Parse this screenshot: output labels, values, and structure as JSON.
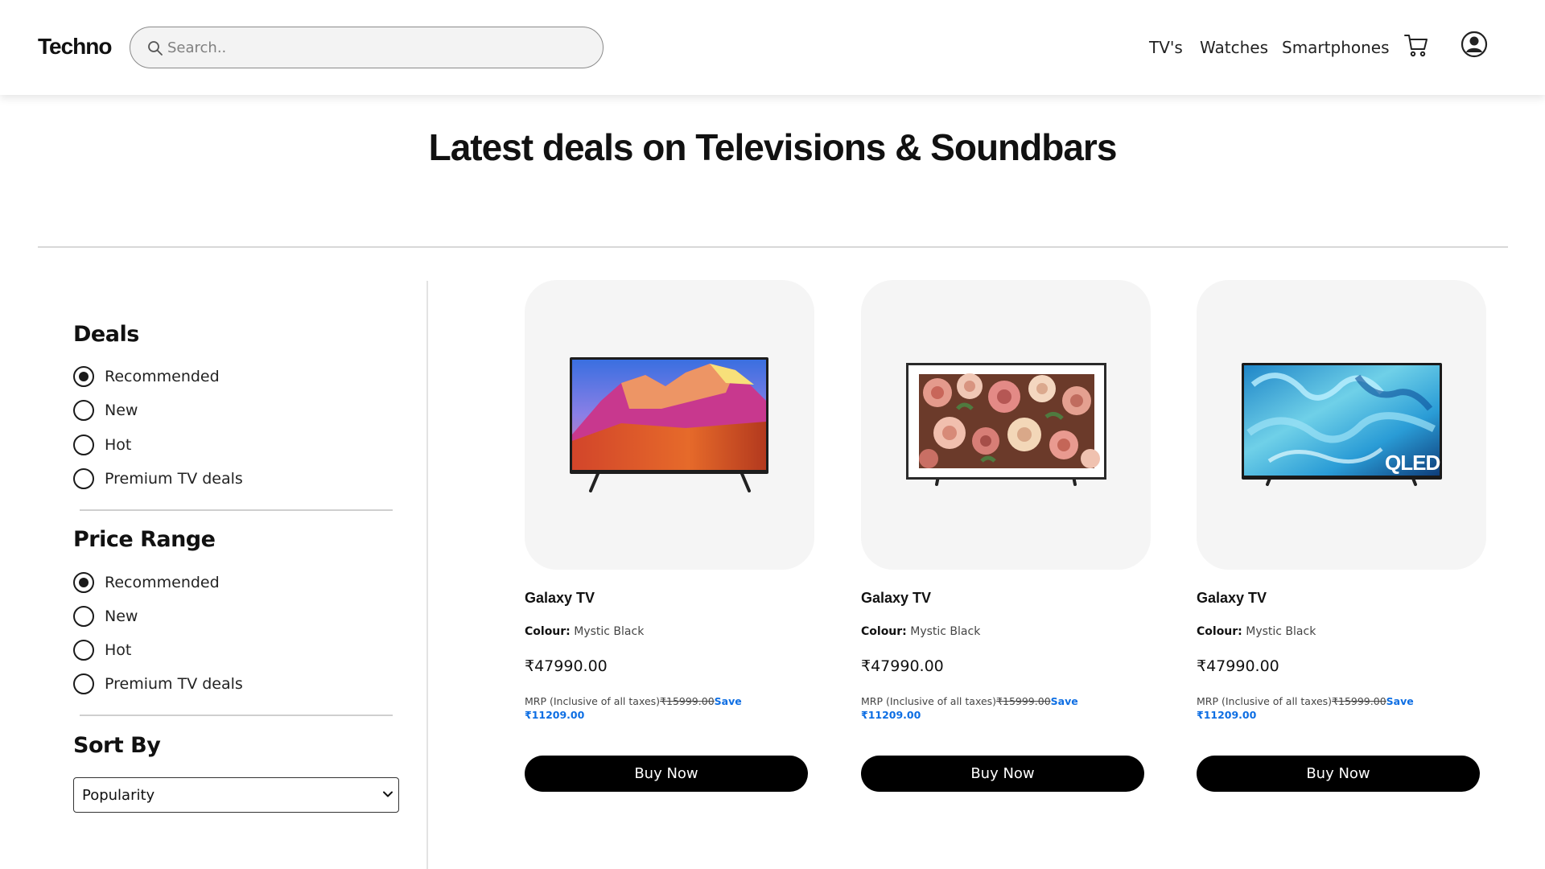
{
  "header": {
    "logo": "Techno",
    "search_placeholder": "Search..",
    "nav": [
      "TV's",
      "Watches",
      "Smartphones"
    ],
    "icons": {
      "search": "search-icon",
      "cart": "cart-icon",
      "account": "user-circle-icon"
    }
  },
  "hero": {
    "title": "Latest deals on Televisions & Soundbars"
  },
  "filters": {
    "deals": {
      "title": "Deals",
      "options": [
        "Recommended",
        "New",
        "Hot",
        "Premium TV deals"
      ],
      "selected": "Recommended"
    },
    "price_range": {
      "title": "Price Range",
      "options": [
        "Recommended",
        "New",
        "Hot",
        "Premium TV deals"
      ],
      "selected": "Recommended"
    },
    "sort": {
      "title": "Sort By",
      "selected": "Popularity"
    }
  },
  "products": [
    {
      "name": "Galaxy TV",
      "colour_label": "Colour:",
      "colour": "Mystic Black",
      "price": "₹47990.00",
      "mrp_label": "MRP (Inclusive of all taxes)",
      "mrp": "₹15999.00",
      "save_label": "Save",
      "save_amount": "₹11209.00",
      "buy_label": "Buy Now",
      "image": "tv-landscape-image"
    },
    {
      "name": "Galaxy TV",
      "colour_label": "Colour:",
      "colour": "Mystic Black",
      "price": "₹47990.00",
      "mrp_label": "MRP (Inclusive of all taxes)",
      "mrp": "₹15999.00",
      "save_label": "Save",
      "save_amount": "₹11209.00",
      "buy_label": "Buy Now",
      "image": "frame-tv-roses-image"
    },
    {
      "name": "Galaxy TV",
      "colour_label": "Colour:",
      "colour": "Mystic Black",
      "price": "₹47990.00",
      "mrp_label": "MRP (Inclusive of all taxes)",
      "mrp": "₹15999.00",
      "save_label": "Save",
      "save_amount": "₹11209.00",
      "buy_label": "Buy Now",
      "image": "qled-tv-image",
      "badge": "QLED"
    }
  ],
  "colors": {
    "accent_save": "#0d6ee3",
    "button_bg": "#000000",
    "card_bg": "#f5f5f5"
  }
}
